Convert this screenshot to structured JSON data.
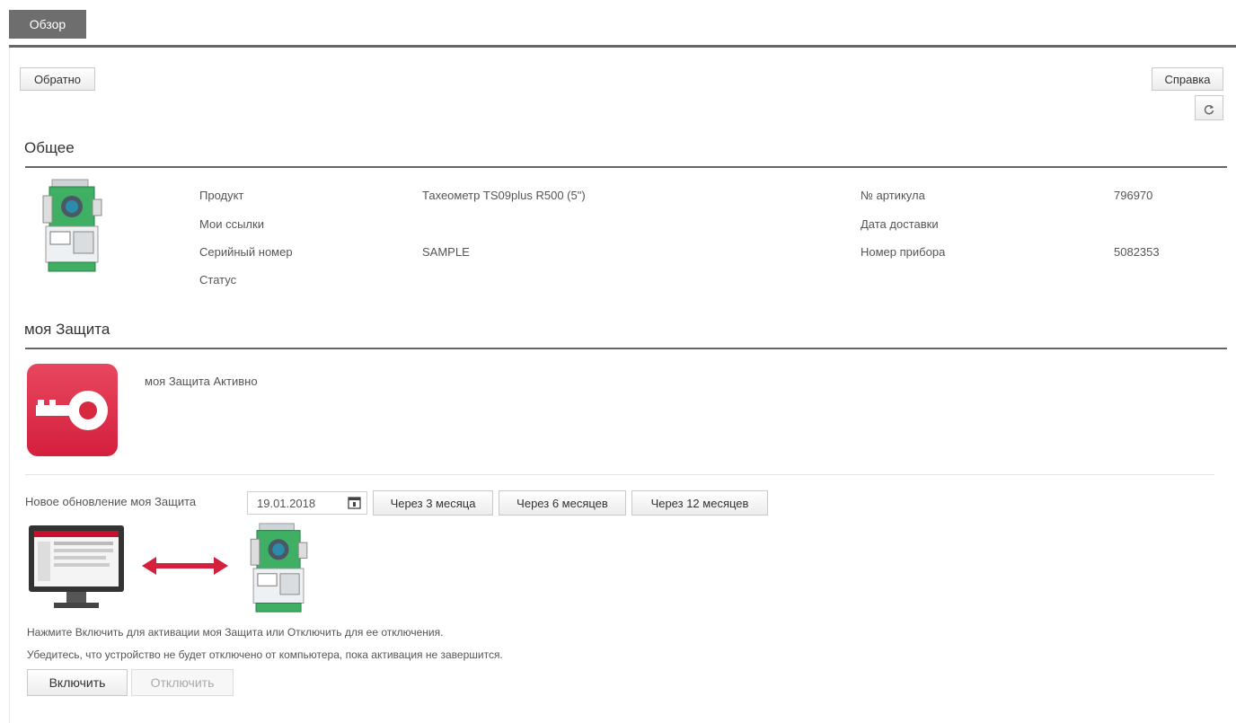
{
  "tabs": {
    "overview": "Обзор"
  },
  "toolbar": {
    "back_label": "Обратно",
    "help_label": "Справка"
  },
  "general": {
    "title": "Общее",
    "product_label": "Продукт",
    "product_value": "Тахеометр TS09plus R500 (5\")",
    "mylinks_label": "Мои ссылки",
    "serial_label": "Серийный номер",
    "serial_value": "SAMPLE",
    "status_label": "Статус",
    "article_label": "№ артикула",
    "article_value": "796970",
    "delivery_label": "Дата доставки",
    "device_label": "Номер прибора",
    "device_value": "5082353"
  },
  "protect": {
    "title": "моя Защита",
    "status_text": "моя Защита Активно",
    "update_label": "Новое обновление моя Защита",
    "date_value": "19.01.2018",
    "btn_3m": "Через 3 месяца",
    "btn_6m": "Через 6 месяцев",
    "btn_12m": "Через 12 месяцев",
    "info1": "Нажмите Включить для активации моя Защита или Отключить для ее отключения.",
    "info2": "Убедитесь, что устройство не будет отключено от компьютера, пока активация не завершится.",
    "enable_label": "Включить",
    "disable_label": "Отключить"
  },
  "colors": {
    "accent_red": "#d41f3d",
    "tab_gray": "#6e6e6e"
  },
  "icons": [
    "refresh-icon",
    "calendar-icon",
    "key-icon",
    "total-station-icon",
    "monitor-icon",
    "double-arrow-icon"
  ]
}
